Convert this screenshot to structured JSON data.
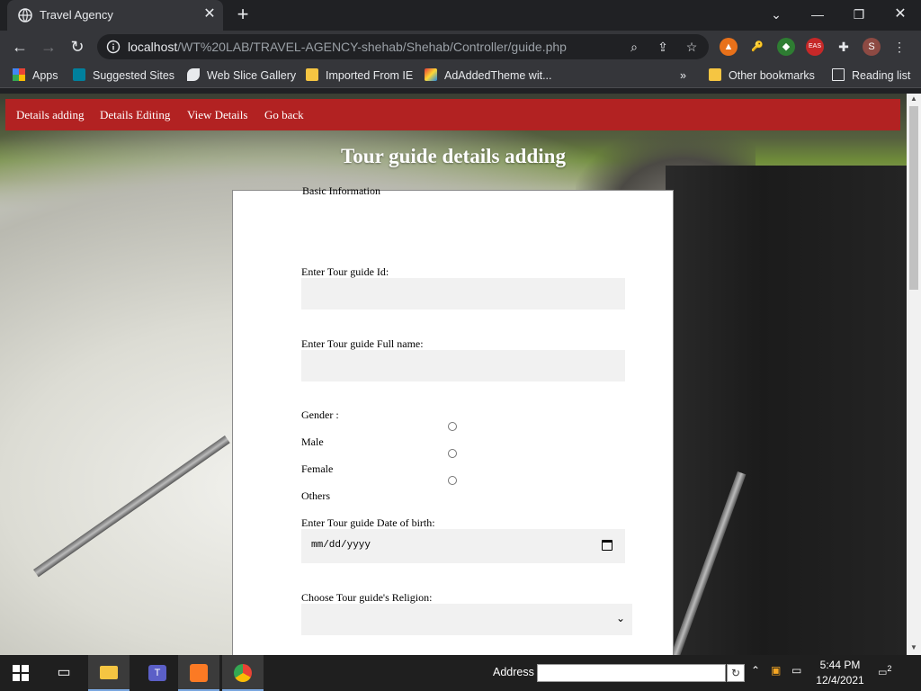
{
  "browser": {
    "tab_title": "Travel Agency",
    "tab_close": "✕",
    "new_tab": "+",
    "url_host": "localhost",
    "url_path": "/WT%20LAB/TRAVEL-AGENCY-shehab/Shehab/Controller/guide.php",
    "profile_initial": "S",
    "ext_badge": "EAS"
  },
  "bookmarks": {
    "items": [
      "Apps",
      "Suggested Sites",
      "Web Slice Gallery",
      "Imported From IE",
      "AdAddedTheme wit..."
    ],
    "more": "»",
    "other": "Other bookmarks",
    "reading_list": "Reading list"
  },
  "page": {
    "nav": [
      "Details adding",
      "Details Editing",
      "View Details",
      "Go back"
    ],
    "title": "Tour guide details adding",
    "legend": "Basic Information",
    "id_label": "Enter Tour guide Id:",
    "name_label": "Enter Tour guide Full name:",
    "gender_label": "Gender :",
    "gender_options": [
      "Male",
      "Female",
      "Others"
    ],
    "dob_label": "Enter Tour guide Date of birth:",
    "dob_placeholder": "mm/dd/yyyy",
    "religion_label": "Choose Tour guide's Religion:",
    "religion_value": ""
  },
  "taskbar": {
    "address_label": "Address",
    "address_value": "",
    "time": "5:44 PM",
    "date": "12/4/2021",
    "notifications": "2"
  },
  "colors": {
    "navbar": "#b22222",
    "chrome_dark": "#202124",
    "chrome_toolbar": "#35363a"
  }
}
